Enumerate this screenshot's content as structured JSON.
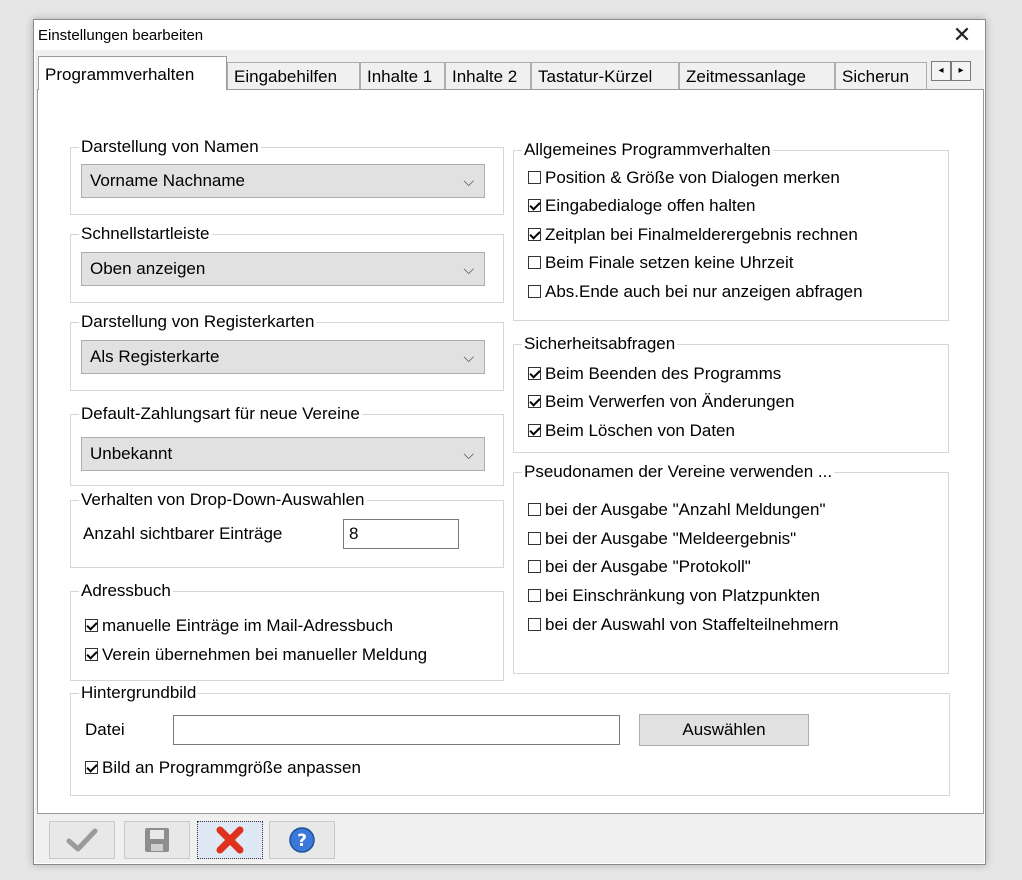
{
  "dialog": {
    "title": "Einstellungen bearbeiten",
    "close_glyph": "✕"
  },
  "tabs": [
    {
      "label": "Programmverhalten",
      "active": true
    },
    {
      "label": "Eingabehilfen"
    },
    {
      "label": "Inhalte 1"
    },
    {
      "label": "Inhalte 2"
    },
    {
      "label": "Tastatur-Kürzel"
    },
    {
      "label": "Zeitmessanlage"
    },
    {
      "label": "Sicherun"
    }
  ],
  "tab_scroll": {
    "left": "◂",
    "right": "▸"
  },
  "left": {
    "names": {
      "label": "Darstellung von Namen",
      "value": "Vorname Nachname"
    },
    "quickstart": {
      "label": "Schnellstartleiste",
      "value": "Oben anzeigen"
    },
    "registertabs": {
      "label": "Darstellung von Registerkarten",
      "value": "Als Registerkarte"
    },
    "payment": {
      "label": "Default-Zahlungsart für neue Vereine",
      "value": "Unbekannt"
    },
    "dropdown": {
      "label": "Verhalten von Drop-Down-Auswahlen",
      "count_label": "Anzahl sichtbarer Einträge",
      "count_value": "8"
    },
    "addressbook": {
      "label": "Adressbuch",
      "items": [
        {
          "label": "manuelle Einträge im Mail-Adressbuch",
          "checked": true
        },
        {
          "label": "Verein übernehmen bei manueller Meldung",
          "checked": true
        }
      ]
    }
  },
  "right": {
    "general": {
      "label": "Allgemeines Programmverhalten",
      "items": [
        {
          "label": "Position & Größe von Dialogen merken",
          "checked": false
        },
        {
          "label": "Eingabedialoge offen halten",
          "checked": true
        },
        {
          "label": "Zeitplan bei Finalmelderergebnis rechnen",
          "checked": true
        },
        {
          "label": "Beim Finale setzen keine Uhrzeit",
          "checked": false
        },
        {
          "label": "Abs.Ende auch bei nur anzeigen abfragen",
          "checked": false
        }
      ]
    },
    "security": {
      "label": "Sicherheitsabfragen",
      "items": [
        {
          "label": "Beim Beenden des Programms",
          "checked": true
        },
        {
          "label": "Beim Verwerfen von Änderungen",
          "checked": true
        },
        {
          "label": "Beim Löschen von Daten",
          "checked": true
        }
      ]
    },
    "pseudonyms": {
      "label": "Pseudonamen der Vereine verwenden ...",
      "items": [
        {
          "label": "bei der Ausgabe \"Anzahl Meldungen\"",
          "checked": false
        },
        {
          "label": "bei der Ausgabe \"Meldeergebnis\"",
          "checked": false
        },
        {
          "label": "bei der Ausgabe \"Protokoll\"",
          "checked": false
        },
        {
          "label": "bei Einschränkung von Platzpunkten",
          "checked": false
        },
        {
          "label": "bei der Auswahl von Staffelteilnehmern",
          "checked": false
        }
      ]
    }
  },
  "background": {
    "label": "Hintergrundbild",
    "file_label": "Datei",
    "file_value": "",
    "choose_label": "Auswählen",
    "fit": {
      "label": "Bild an Programmgröße anpassen",
      "checked": true
    }
  },
  "toolbar": {
    "icons": [
      "checkmark-icon",
      "save-icon",
      "cancel-icon",
      "help-icon"
    ]
  },
  "colors": {
    "cancel_red": "#e0301e",
    "help_blue": "#3b78d8"
  }
}
